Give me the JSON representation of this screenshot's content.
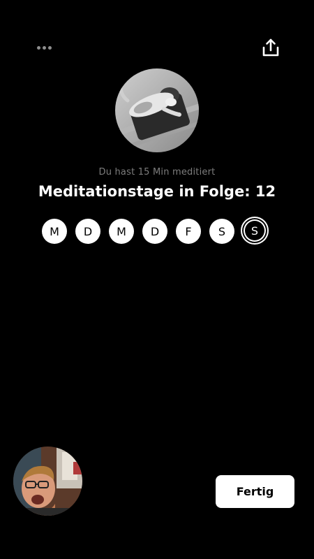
{
  "header": {
    "more_icon": "more-horizontal-icon",
    "share_icon": "share-upload-icon"
  },
  "session": {
    "summary": "Du hast 15 Min meditiert",
    "streak_title": "Meditationstage in Folge: 12"
  },
  "week": {
    "days": [
      "M",
      "D",
      "M",
      "D",
      "F",
      "S",
      "S"
    ],
    "today_index": 6
  },
  "footer": {
    "done_label": "Fertig"
  },
  "colors": {
    "background": "#000000",
    "text_primary": "#ffffff",
    "text_secondary": "#7d7d7d",
    "icon_muted": "#8e8e8e",
    "button_bg": "#ffffff"
  }
}
